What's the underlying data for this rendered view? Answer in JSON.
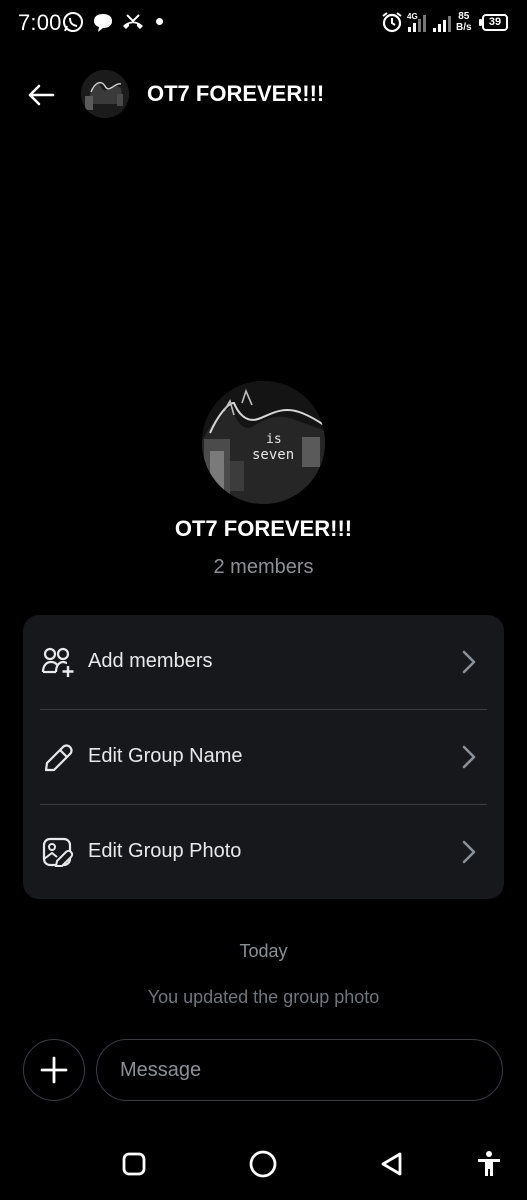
{
  "status_bar": {
    "time": "7:00",
    "net_speed_value": "85",
    "net_speed_unit": "B/s",
    "network_type": "4G",
    "battery_level": "39",
    "icons": [
      "whatsapp-icon",
      "chat-bubble-icon",
      "missed-call-icon",
      "notification-dot",
      "alarm-icon",
      "signal-icon",
      "wifi-signal-icon",
      "battery-icon"
    ]
  },
  "header": {
    "title": "OT7 FOREVER!!!",
    "back_icon": "arrow-left-icon"
  },
  "profile": {
    "avatar_text_line1": "is",
    "avatar_text_line2": "seven",
    "group_name": "OT7 FOREVER!!!",
    "member_count": "2 members"
  },
  "options": [
    {
      "label": "Add members",
      "icon": "add-people-icon"
    },
    {
      "label": "Edit Group Name",
      "icon": "pencil-icon"
    },
    {
      "label": "Edit Group Photo",
      "icon": "photo-edit-icon"
    }
  ],
  "chat": {
    "date_separator": "Today",
    "system_message": "You updated the group photo"
  },
  "composer": {
    "placeholder": "Message",
    "add_icon": "plus-icon"
  },
  "nav_bar": {
    "icons": [
      "recents-square-icon",
      "home-circle-icon",
      "back-triangle-icon",
      "accessibility-icon"
    ]
  },
  "colors": {
    "background": "#000000",
    "card": "#16181c",
    "text_primary": "#e7e9ea",
    "text_secondary": "#8b9096",
    "border": "#3a3d42"
  }
}
